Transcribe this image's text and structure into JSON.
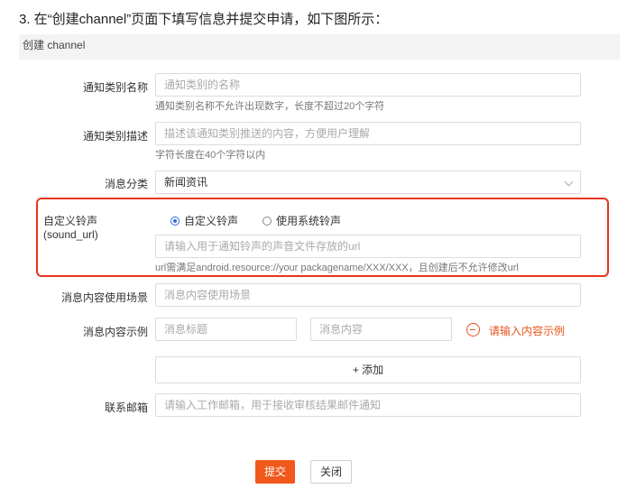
{
  "step_title": "3. 在“创建channel”页面下填写信息并提交申请，如下图所示：",
  "panel_title": "创建 channel",
  "fields": {
    "category_name": {
      "label": "通知类别名称",
      "placeholder": "通知类别的名称",
      "hint": "通知类别名称不允许出现数字，长度不超过20个字符"
    },
    "category_desc": {
      "label": "通知类别描述",
      "placeholder": "描述该通知类别推送的内容，方便用户理解",
      "hint": "字符长度在40个字符以内"
    },
    "message_category": {
      "label": "消息分类",
      "value": "新闻资讯"
    },
    "sound": {
      "label": "自定义铃声 (sound_url)",
      "option_custom": "自定义铃声",
      "option_system": "使用系统铃声",
      "selected": "自定义铃声",
      "placeholder": "请输入用于通知铃声的声音文件存放的url",
      "hint": "url需满足android.resource://your packagename/XXX/XXX，且创建后不允许修改url"
    },
    "usage_scene": {
      "label": "消息内容使用场景",
      "placeholder": "消息内容使用场景"
    },
    "example": {
      "label": "消息内容示例",
      "title_placeholder": "消息标题",
      "content_placeholder": "消息内容",
      "error": "请输入内容示例",
      "add_label": "+ 添加"
    },
    "email": {
      "label": "联系邮箱",
      "placeholder": "请输入工作邮箱，用于接收审核结果邮件通知"
    }
  },
  "buttons": {
    "submit": "提交",
    "close": "关闭"
  },
  "colors": {
    "accent": "#f0591b",
    "highlight_border": "#e8341c",
    "radio_selected": "#2d6be0"
  }
}
